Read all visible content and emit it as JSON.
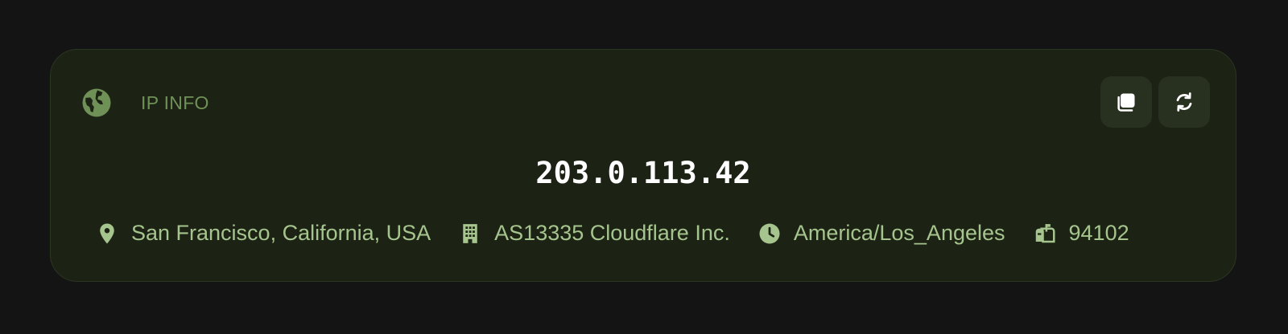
{
  "card": {
    "title": "IP INFO",
    "ip": "203.0.113.42",
    "icons": {
      "header": "globe-icon",
      "copy": "copy-icon",
      "refresh": "refresh-icon",
      "location": "map-pin-icon",
      "asn": "building-icon",
      "timezone": "clock-icon",
      "postal": "mailbox-icon"
    },
    "details": {
      "location": "San Francisco, California, USA",
      "asn": "AS13335 Cloudflare Inc.",
      "timezone": "America/Los_Angeles",
      "postal": "94102"
    }
  },
  "colors": {
    "background": "#141414",
    "card": "#1c2315",
    "accent": "#6f9157",
    "detail_text": "#a6c48d",
    "button_bg": "#28301f",
    "ip_text": "#ffffff"
  }
}
